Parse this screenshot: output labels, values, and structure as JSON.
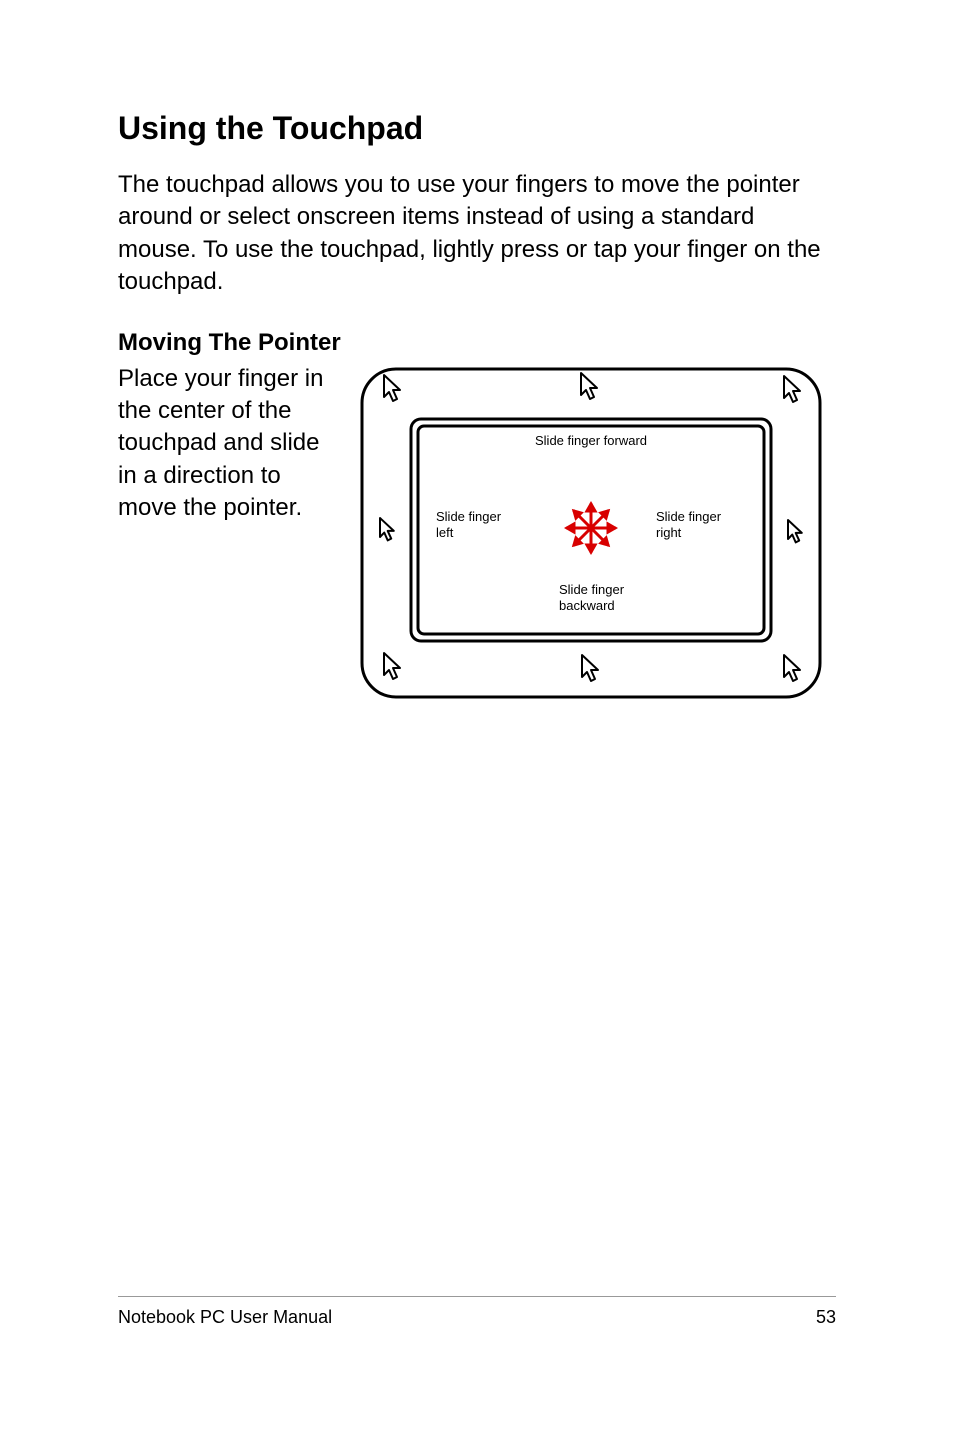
{
  "heading": "Using the Touchpad",
  "body_para": "The touchpad allows you to use your fingers to move the pointer around or select onscreen items instead of using a standard mouse. To use the touchpad, lightly press or tap your finger on the touchpad.",
  "subheading": "Moving The Pointer",
  "left_text": "Place your finger in the center of the touchpad and slide in a direction to move the pointer.",
  "diagram": {
    "forward": "Slide finger forward",
    "left_l1": "Slide finger",
    "left_l2": "left",
    "right_l1": "Slide finger",
    "right_l2": "right",
    "back_l1": "Slide finger",
    "back_l2": "backward"
  },
  "footer": {
    "left": "Notebook PC User Manual",
    "right": "53"
  }
}
